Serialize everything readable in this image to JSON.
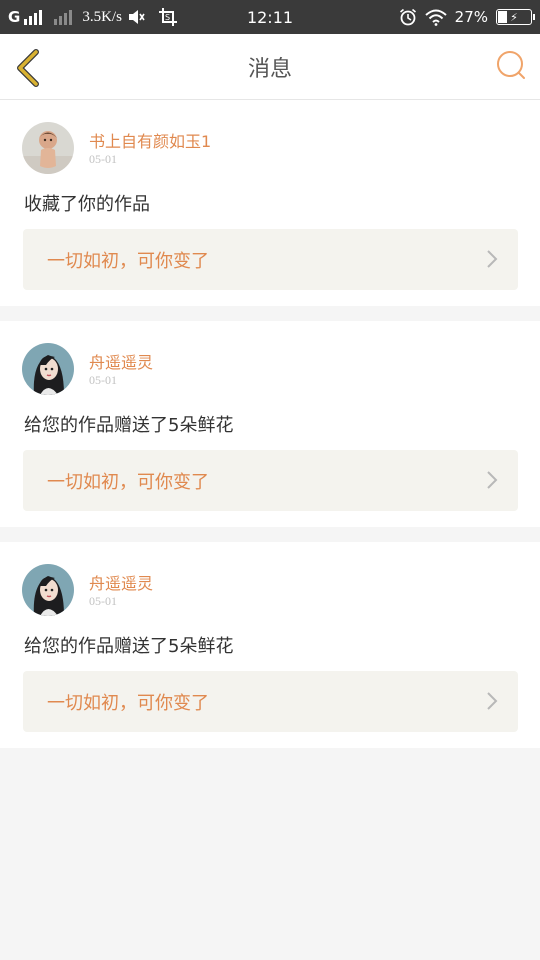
{
  "status_bar": {
    "carrier": "G",
    "speed": "3.5K/s",
    "time": "12:11",
    "battery": "27%"
  },
  "header": {
    "title": "消息",
    "back_icon": "chevron-left-icon",
    "search_icon": "search-icon"
  },
  "colors": {
    "accent": "#e0894f",
    "back_arrow": "#d9b232",
    "link_bg": "#f4f3ee"
  },
  "messages": [
    {
      "username": "书上自有颜如玉1",
      "date": "05-01",
      "text": "收藏了你的作品",
      "work_title": "一切如初，可你变了",
      "avatar": "doll-avatar"
    },
    {
      "username": "舟遥遥灵",
      "date": "05-01",
      "text": "给您的作品赠送了5朵鲜花",
      "work_title": "一切如初，可你变了",
      "avatar": "girl-avatar"
    },
    {
      "username": "舟遥遥灵",
      "date": "05-01",
      "text": "给您的作品赠送了5朵鲜花",
      "work_title": "一切如初，可你变了",
      "avatar": "girl-avatar"
    }
  ]
}
